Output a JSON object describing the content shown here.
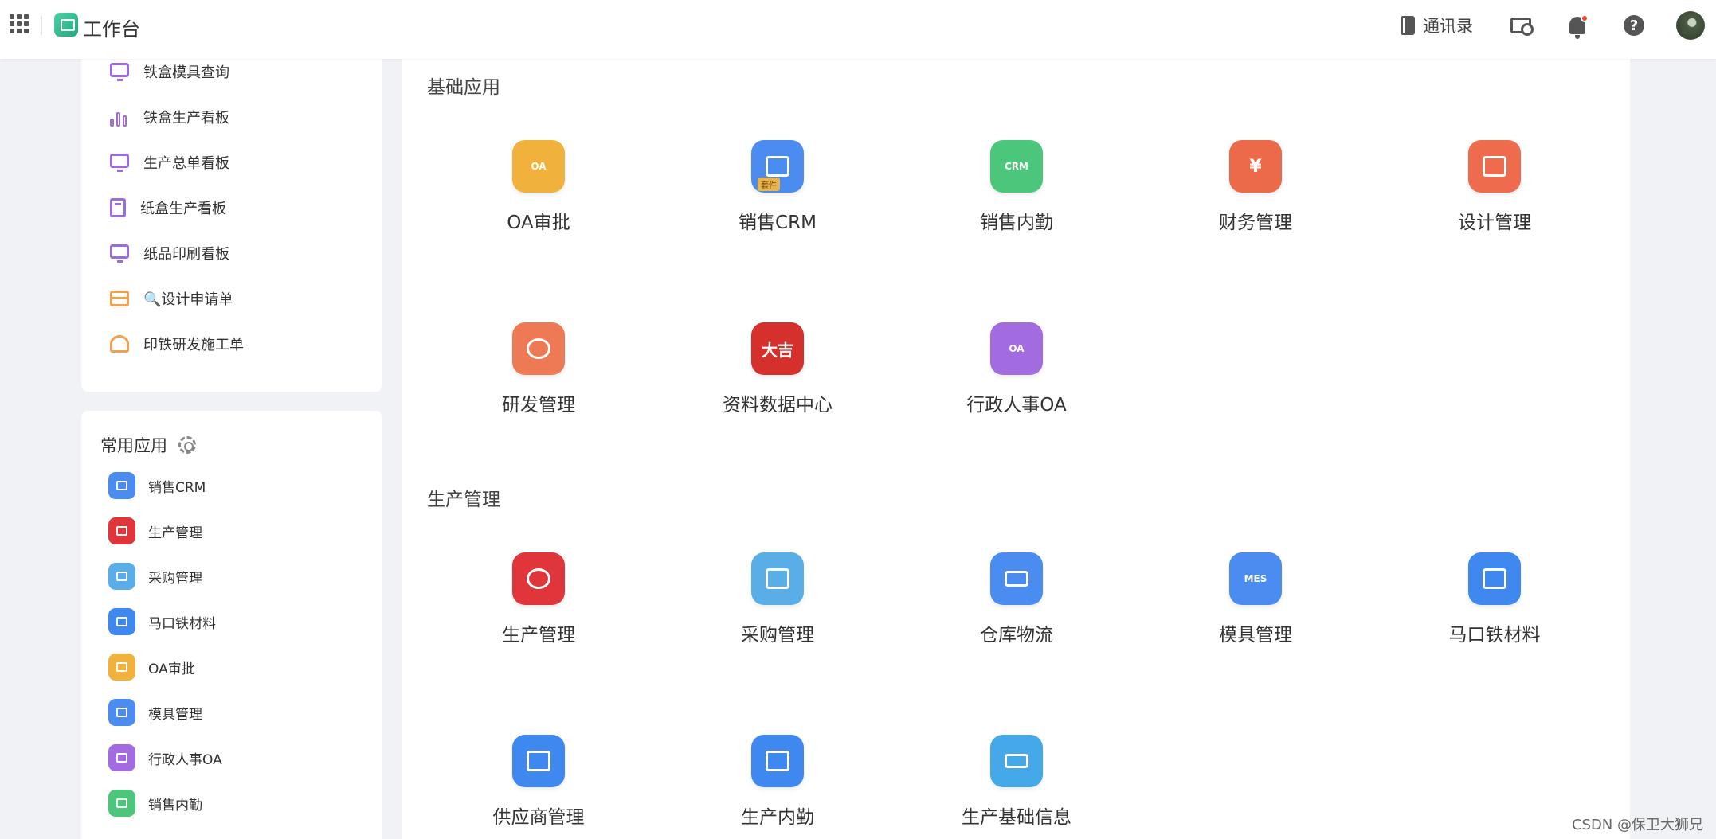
{
  "header": {
    "app_title": "工作台",
    "contacts_label": "通讯录"
  },
  "sidebar_menu": [
    {
      "label": "铁盒模具查询",
      "icon": "monitor-icon"
    },
    {
      "label": "铁盒生产看板",
      "icon": "bar-chart-icon"
    },
    {
      "label": "生产总单看板",
      "icon": "monitor-icon"
    },
    {
      "label": "纸盒生产看板",
      "icon": "calculator-icon"
    },
    {
      "label": "纸品印刷看板",
      "icon": "monitor-icon"
    },
    {
      "label": "🔍设计申请单",
      "icon": "store-icon"
    },
    {
      "label": "印铁研发施工单",
      "icon": "alarm-icon"
    }
  ],
  "favorites": {
    "title": "常用应用",
    "items": [
      {
        "label": "销售CRM",
        "icon": "hexagon-icon",
        "color": "#4a8cf0"
      },
      {
        "label": "生产管理",
        "icon": "factory-icon",
        "color": "#e0353a"
      },
      {
        "label": "采购管理",
        "icon": "hand-icon",
        "color": "#5aaee8"
      },
      {
        "label": "马口铁材料",
        "icon": "shop-icon",
        "color": "#3f88f0"
      },
      {
        "label": "OA审批",
        "icon": "document-icon",
        "color": "#f0b23c"
      },
      {
        "label": "模具管理",
        "icon": "mold-icon",
        "color": "#4a8cf0"
      },
      {
        "label": "行政人事OA",
        "icon": "document-icon",
        "color": "#a26ce0"
      },
      {
        "label": "销售内勤",
        "icon": "crm-icon",
        "color": "#4bc67a"
      }
    ]
  },
  "sections": [
    {
      "title": "基础应用",
      "apps": [
        {
          "label": "OA审批",
          "icon": "oa-icon",
          "color": "#f0b23c",
          "badge": "OA"
        },
        {
          "label": "销售CRM",
          "icon": "hexagon-icon",
          "color": "#4a8cf0",
          "tag": "套件"
        },
        {
          "label": "销售内勤",
          "icon": "crm-icon",
          "color": "#4bc67a",
          "badge": "CRM"
        },
        {
          "label": "财务管理",
          "icon": "yuan-icon",
          "color": "#ec6a4a",
          "badge": "¥"
        },
        {
          "label": "设计管理",
          "icon": "shop-icon",
          "color": "#ee6b4e"
        },
        {
          "label": "研发管理",
          "icon": "planet-icon",
          "color": "#ee7a55"
        },
        {
          "label": "资料数据中心",
          "icon": "calligraphy-icon",
          "color": "#d6302c",
          "badge": "大吉"
        },
        {
          "label": "行政人事OA",
          "icon": "oa-icon",
          "color": "#a26ce0",
          "badge": "OA"
        }
      ]
    },
    {
      "title": "生产管理",
      "apps": [
        {
          "label": "生产管理",
          "icon": "factory-icon",
          "color": "#e0353a"
        },
        {
          "label": "采购管理",
          "icon": "hand-icon",
          "color": "#5aaee8"
        },
        {
          "label": "仓库物流",
          "icon": "truck-icon",
          "color": "#4a8cf0"
        },
        {
          "label": "模具管理",
          "icon": "mes-icon",
          "color": "#4a8cf0",
          "badge": "MES"
        },
        {
          "label": "马口铁材料",
          "icon": "shop-icon",
          "color": "#3f88f0"
        },
        {
          "label": "供应商管理",
          "icon": "warehouse-icon",
          "color": "#3f88f0"
        },
        {
          "label": "生产内勤",
          "icon": "warehouse-icon",
          "color": "#3f88f0"
        },
        {
          "label": "生产基础信息",
          "icon": "cart-icon",
          "color": "#45a8e8"
        }
      ]
    }
  ],
  "watermark": "CSDN @保卫大狮兄"
}
